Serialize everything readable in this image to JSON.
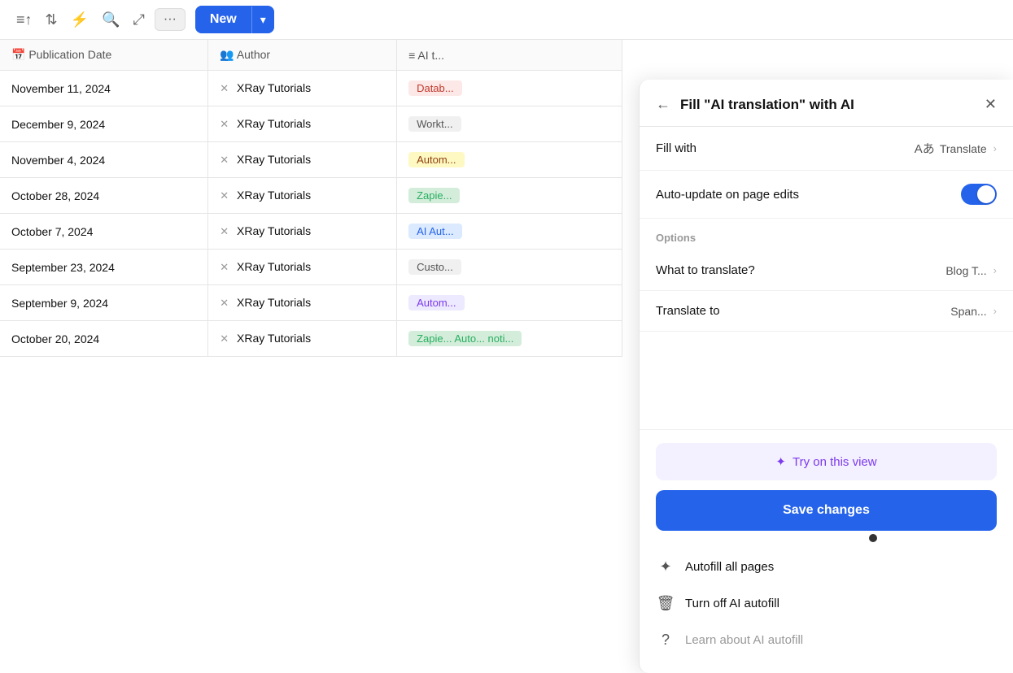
{
  "toolbar": {
    "icons": [
      "filter",
      "sort",
      "lightning",
      "search",
      "connect"
    ],
    "more_label": "···",
    "new_label": "New",
    "chevron": "▾"
  },
  "table": {
    "columns": [
      {
        "icon": "📅",
        "label": "Publication Date"
      },
      {
        "icon": "👥",
        "label": "Author"
      },
      {
        "icon": "≡",
        "label": "AI t..."
      }
    ],
    "rows": [
      {
        "date": "November 11, 2024",
        "author": "XRay Tutorials",
        "tag": "Datab...",
        "tag_class": "tag-red"
      },
      {
        "date": "December 9, 2024",
        "author": "XRay Tutorials",
        "tag": "Workt...",
        "tag_class": "tag-gray"
      },
      {
        "date": "November 4, 2024",
        "author": "XRay Tutorials",
        "tag": "Autom...",
        "tag_class": "tag-yellow"
      },
      {
        "date": "October 28, 2024",
        "author": "XRay Tutorials",
        "tag": "Zapie...",
        "tag_class": "tag-green"
      },
      {
        "date": "October 7, 2024",
        "author": "XRay Tutorials",
        "tag": "AI Aut...",
        "tag_class": "tag-blue"
      },
      {
        "date": "September 23, 2024",
        "author": "XRay Tutorials",
        "tag": "Custo...",
        "tag_class": "tag-gray"
      },
      {
        "date": "September 9, 2024",
        "author": "XRay Tutorials",
        "tag": "Autom...",
        "tag_class": "tag-purple"
      },
      {
        "date": "October 20, 2024",
        "author": "XRay Tutorials",
        "tag": "Zapie... Auto... noti...",
        "tag_class": "tag-green"
      }
    ]
  },
  "panel": {
    "title": "Fill \"AI translation\" with AI",
    "back_label": "←",
    "close_label": "✕",
    "fill_with_label": "Fill with",
    "fill_with_value": "Translate",
    "auto_update_label": "Auto-update on page edits",
    "options_label": "Options",
    "what_translate_label": "What to translate?",
    "what_translate_value": "Blog T...",
    "translate_to_label": "Translate to",
    "translate_to_value": "Span...",
    "try_label": "Try on this view",
    "save_label": "Save changes",
    "autofill_label": "Autofill all pages",
    "turnoff_label": "Turn off AI autofill",
    "learn_label": "Learn about AI autofill"
  }
}
